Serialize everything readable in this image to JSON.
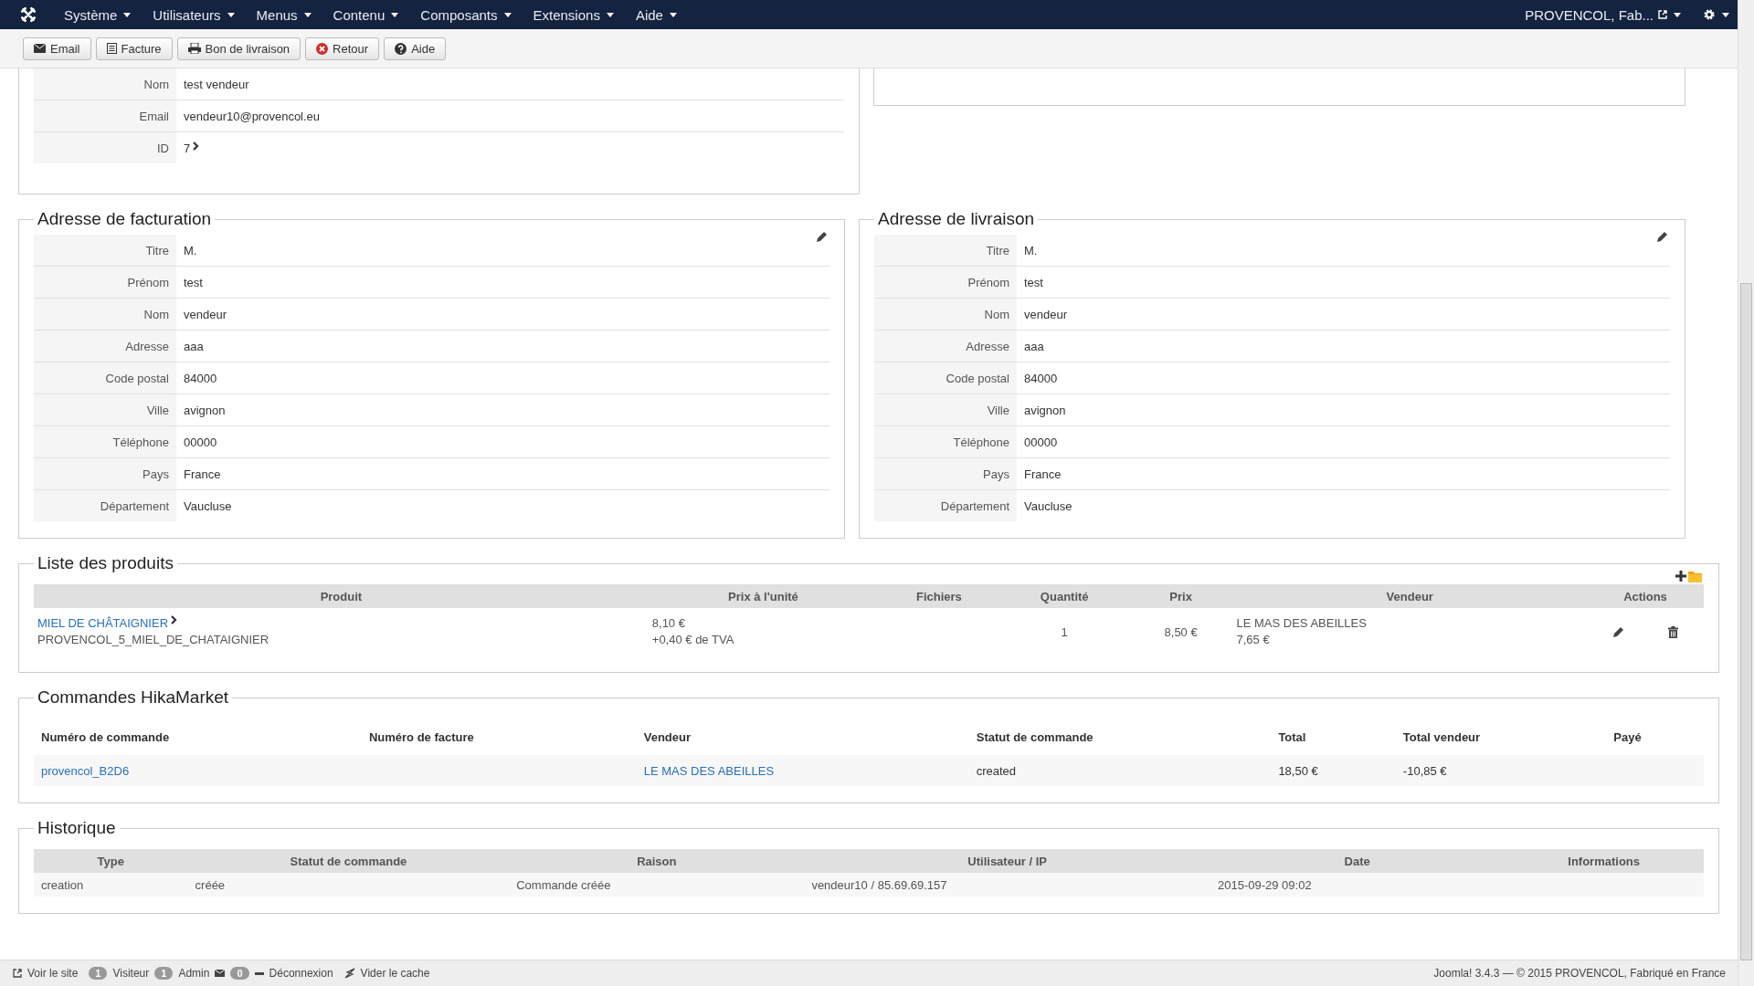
{
  "menu": {
    "items": [
      {
        "label": "Système"
      },
      {
        "label": "Utilisateurs"
      },
      {
        "label": "Menus"
      },
      {
        "label": "Contenu"
      },
      {
        "label": "Composants"
      },
      {
        "label": "Extensions"
      },
      {
        "label": "Aide"
      }
    ],
    "user": "PROVENCOL, Fab..."
  },
  "toolbar": [
    {
      "label": "Email",
      "kind": "mail"
    },
    {
      "label": "Facture",
      "kind": "invoice"
    },
    {
      "label": "Bon de livraison",
      "kind": "print"
    },
    {
      "label": "Retour",
      "kind": "back"
    },
    {
      "label": "Aide",
      "kind": "help"
    }
  ],
  "vendor": {
    "rows": [
      {
        "label": "Nom",
        "value": "test vendeur"
      },
      {
        "label": "Email",
        "value": "vendeur10@provencol.eu"
      },
      {
        "label": "ID",
        "value": "7"
      }
    ]
  },
  "addresses": [
    {
      "title": "Adresse de facturation",
      "rows": [
        {
          "label": "Titre",
          "value": "M."
        },
        {
          "label": "Prénom",
          "value": "test"
        },
        {
          "label": "Nom",
          "value": "vendeur"
        },
        {
          "label": "Adresse",
          "value": "aaa"
        },
        {
          "label": "Code postal",
          "value": "84000"
        },
        {
          "label": "Ville",
          "value": "avignon"
        },
        {
          "label": "Téléphone",
          "value": "00000"
        },
        {
          "label": "Pays",
          "value": "France"
        },
        {
          "label": "Département",
          "value": "Vaucluse"
        }
      ]
    },
    {
      "title": "Adresse de livraison",
      "rows": [
        {
          "label": "Titre",
          "value": "M."
        },
        {
          "label": "Prénom",
          "value": "test"
        },
        {
          "label": "Nom",
          "value": "vendeur"
        },
        {
          "label": "Adresse",
          "value": "aaa"
        },
        {
          "label": "Code postal",
          "value": "84000"
        },
        {
          "label": "Ville",
          "value": "avignon"
        },
        {
          "label": "Téléphone",
          "value": "00000"
        },
        {
          "label": "Pays",
          "value": "France"
        },
        {
          "label": "Département",
          "value": "Vaucluse"
        }
      ]
    }
  ],
  "products": {
    "title": "Liste des produits",
    "columns": [
      "Produit",
      "Prix à l'unité",
      "Fichiers",
      "Quantité",
      "Prix",
      "Vendeur",
      "Actions"
    ],
    "rows": [
      {
        "name": "MIEL DE CHÂTAIGNIER",
        "code": "PROVENCOL_5_MIEL_DE_CHATAIGNIER",
        "unit_price": "8,10 €",
        "tax": "+0,40 € de TVA",
        "quantity": "1",
        "price": "8,50 €",
        "vendor": "LE MAS DES ABEILLES",
        "vendor_price": "7,65 €"
      }
    ]
  },
  "orders": {
    "title": "Commandes HikaMarket",
    "columns": [
      "Numéro de commande",
      "Numéro de facture",
      "Vendeur",
      "Statut de commande",
      "Total",
      "Total vendeur",
      "Payé"
    ],
    "rows": [
      {
        "number": "provencol_B2D6",
        "vendor": "LE MAS DES ABEILLES",
        "status": "created",
        "total": "18,50 €",
        "vendor_total": "-10,85 €"
      }
    ]
  },
  "history": {
    "title": "Historique",
    "columns": [
      "Type",
      "Statut de commande",
      "Raison",
      "Utilisateur / IP",
      "Date",
      "Informations"
    ],
    "rows": [
      {
        "type": "creation",
        "status": "créée",
        "reason": "Commande créée",
        "user": "vendeur10 / 85.69.69.157",
        "date": "2015-09-29 09:02"
      }
    ]
  },
  "status_bar": {
    "view_site": "Voir le site",
    "visitors": "1",
    "visitors_label": "Visiteur",
    "admins": "1",
    "admins_label": "Admin",
    "messages": "0",
    "logout": "Déconnexion",
    "clear_cache": "Vider le cache",
    "footer": "Joomla! 3.4.3 — © 2015 PROVENCOL, Fabriqué en France"
  }
}
